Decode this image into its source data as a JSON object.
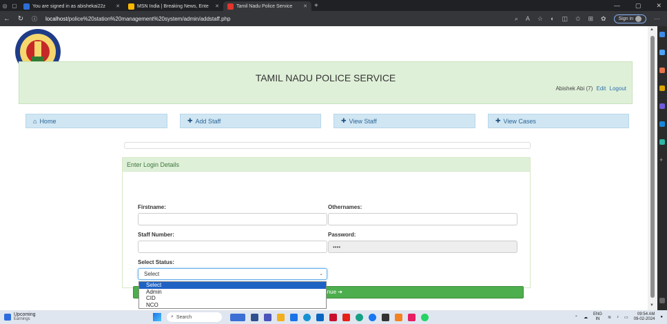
{
  "browser": {
    "tabs": [
      {
        "label": "You are signed in as abishekai22z",
        "favicon_color": "#2c6dd6"
      },
      {
        "label": "MSN India | Breaking News, Ente",
        "favicon_color": "#ffb900"
      },
      {
        "label": "Tamil Nadu Police Service",
        "favicon_color": "#e2352b",
        "active": true
      }
    ],
    "url_host": "localhost",
    "url_path": "/police%20station%20management%20system/admin/addstaff.php",
    "signin_label": "Sign in"
  },
  "header": {
    "site_title": "TAMIL NADU POLICE SERVICE",
    "user_text": "Abishek Abi (7)",
    "edit_link": "Edit",
    "logout_link": "Logout"
  },
  "nav": [
    {
      "label": "Home",
      "icon": "home-icon"
    },
    {
      "label": "Add Staff",
      "icon": "plus-icon"
    },
    {
      "label": "View Staff",
      "icon": "plus-icon"
    },
    {
      "label": "View Cases",
      "icon": "plus-icon"
    }
  ],
  "form": {
    "panel_title": "Enter Login Details",
    "firstname_label": "Firstname:",
    "othernames_label": "Othernames:",
    "staff_number_label": "Staff Number:",
    "password_label": "Password:",
    "password_value": "••••",
    "status_label": "Select Status:",
    "status_selected": "Select",
    "status_options": [
      "Select",
      "Admin",
      "CID",
      "NCO"
    ],
    "continue_label": "Continue ➔"
  },
  "taskbar": {
    "widget_title": "Upcoming",
    "widget_sub": "Earnings",
    "search_label": "Search",
    "lang_top": "ENG",
    "lang_bottom": "IN",
    "time": "09:54 AM",
    "date": "09-02-2024"
  },
  "colors": {
    "banner_bg": "#dff0d8",
    "nav_bg": "#d0e6f3",
    "continue_bg": "#4cae4c",
    "dropdown_highlight": "#1e62c4"
  }
}
